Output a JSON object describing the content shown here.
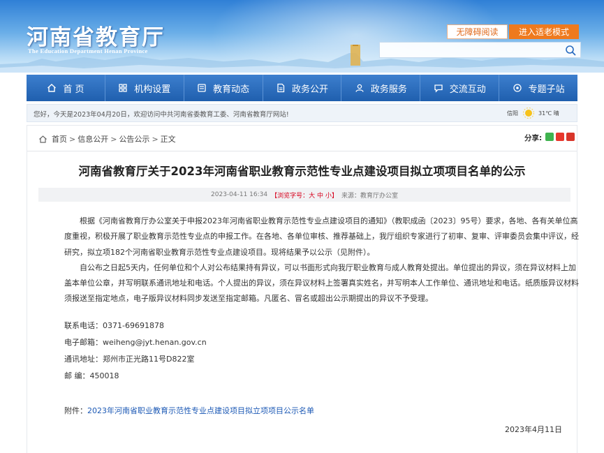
{
  "header": {
    "title": "河南省教育厅",
    "subtitle": "The Education Department Henan Province",
    "accessible_label": "无障碍阅读",
    "elder_mode_label": "进入适老模式",
    "search_placeholder": ""
  },
  "nav": {
    "items": [
      {
        "label": "首 页",
        "icon": "home-icon"
      },
      {
        "label": "机构设置",
        "icon": "org-icon"
      },
      {
        "label": "教育动态",
        "icon": "news-icon"
      },
      {
        "label": "政务公开",
        "icon": "doc-icon"
      },
      {
        "label": "政务服务",
        "icon": "service-icon"
      },
      {
        "label": "交流互动",
        "icon": "chat-icon"
      },
      {
        "label": "专题子站",
        "icon": "topic-icon"
      }
    ]
  },
  "welcome": {
    "text": "您好，今天是2023年04月20日，欢迎访问中共河南省委教育工委、河南省教育厅网站!",
    "weather_city": "信阳",
    "weather_temp": "31℃ 晴"
  },
  "breadcrumb": {
    "items": [
      "首页",
      "信息公开",
      "公告公示",
      "正文"
    ],
    "separator": ">"
  },
  "share": {
    "label": "分享:"
  },
  "article": {
    "title": "河南省教育厅关于2023年河南省职业教育示范性专业点建设项目拟立项项目名单的公示",
    "datetime": "2023-04-11 16:34",
    "font_label": "【浏览字号：",
    "font_large": "大",
    "font_medium": "中",
    "font_small": "小",
    "font_close": "】",
    "source": "来源：教育厅办公室",
    "paragraphs": [
      "根据《河南省教育厅办公室关于申报2023年河南省职业教育示范性专业点建设项目的通知》（教职成函〔2023〕95号）要求，各地、各有关单位高度重视，积极开展了职业教育示范性专业点的申报工作。在各地、各单位审核、推荐基础上，我厅组织专家进行了初审、复审、评审委员会集中评议，经研究，拟立项182个河南省职业教育示范性专业点建设项目。现将结果予以公示（见附件）。",
      "自公布之日起5天内，任何单位和个人对公布结果持有异议，可以书面形式向我厅职业教育与成人教育处提出。单位提出的异议，须在异议材料上加盖本单位公章，并写明联系通讯地址和电话。个人提出的异议，须在异议材料上签署真实姓名，并写明本人工作单位、通讯地址和电话。纸质版异议材料须报送至指定地点，电子版异议材料同步发送至指定邮箱。凡匿名、冒名或超出公示期提出的异议不予受理。"
    ],
    "contact": {
      "phone": "联系电话：0371-69691878",
      "email": "电子邮箱：weiheng@jyt.henan.gov.cn",
      "address": "通讯地址：郑州市正光路11号D822室",
      "postcode": "邮 编：450018"
    },
    "attachment_label": "附件：",
    "attachment_link": "2023年河南省职业教育示范性专业点建设项目拟立项项目公示名单",
    "date": "2023年4月11日"
  },
  "colors": {
    "nav_blue": "#2667b8",
    "accent_orange": "#ef7a1e",
    "link_blue": "#1c59b5",
    "highlight_red": "#d6001c"
  }
}
